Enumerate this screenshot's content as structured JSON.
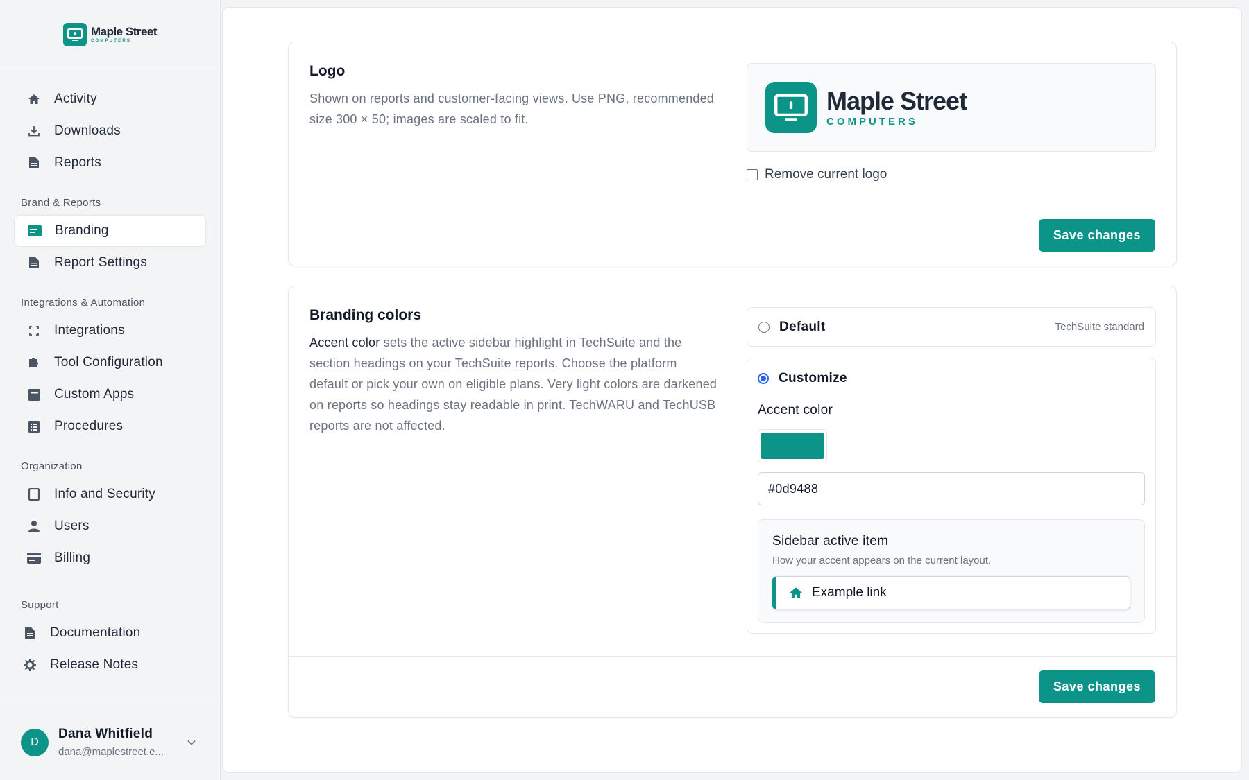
{
  "brand": {
    "name": "Maple Street",
    "sub": "COMPUTERS"
  },
  "sidebar": {
    "primary": [
      {
        "label": "Activity",
        "icon": "home-icon"
      },
      {
        "label": "Downloads",
        "icon": "download-icon"
      },
      {
        "label": "Reports",
        "icon": "document-icon"
      }
    ],
    "sections": [
      {
        "title": "Brand & Reports",
        "items": [
          {
            "label": "Branding",
            "icon": "id-card-icon",
            "active": true
          },
          {
            "label": "Report Settings",
            "icon": "document-icon"
          }
        ]
      },
      {
        "title": "Integrations & Automation",
        "items": [
          {
            "label": "Integrations",
            "icon": "integrations-icon"
          },
          {
            "label": "Tool Configuration",
            "icon": "puzzle-icon"
          },
          {
            "label": "Custom Apps",
            "icon": "app-icon"
          },
          {
            "label": "Procedures",
            "icon": "list-icon"
          }
        ]
      },
      {
        "title": "Organization",
        "items": [
          {
            "label": "Info and Security",
            "icon": "square-icon"
          },
          {
            "label": "Users",
            "icon": "user-icon"
          },
          {
            "label": "Billing",
            "icon": "card-icon"
          }
        ]
      },
      {
        "title": "Support",
        "items": [
          {
            "label": "Documentation",
            "icon": "document-icon"
          },
          {
            "label": "Release Notes",
            "icon": "gear-icon"
          }
        ]
      }
    ]
  },
  "user": {
    "initial": "D",
    "name": "Dana Whitfield",
    "email": "dana@maplestreet.e..."
  },
  "logo_card": {
    "title": "Logo",
    "description": "Shown on reports and customer-facing views. Use PNG, recommended size 300 × 50; images are scaled to fit.",
    "remove_label": "Remove current logo",
    "save_label": "Save changes"
  },
  "colors_card": {
    "title": "Branding colors",
    "description_lead": "Accent color",
    "description_rest": " sets the active sidebar highlight in TechSuite and the section headings on your TechSuite reports. Choose the platform default or pick your own on eligible plans. Very light colors are darkened on reports so headings stay readable in print. TechWARU and TechUSB reports are not affected.",
    "default_label": "Default",
    "default_hint": "TechSuite standard",
    "customize_label": "Customize",
    "accent_label": "Accent color",
    "accent_value": "#0d9488",
    "preview_title": "Sidebar active item",
    "preview_sub": "How your accent appears on the current layout.",
    "example_link": "Example link",
    "save_label": "Save changes"
  },
  "colors": {
    "accent": "#0d9488",
    "radio_selected": "#2563eb"
  }
}
